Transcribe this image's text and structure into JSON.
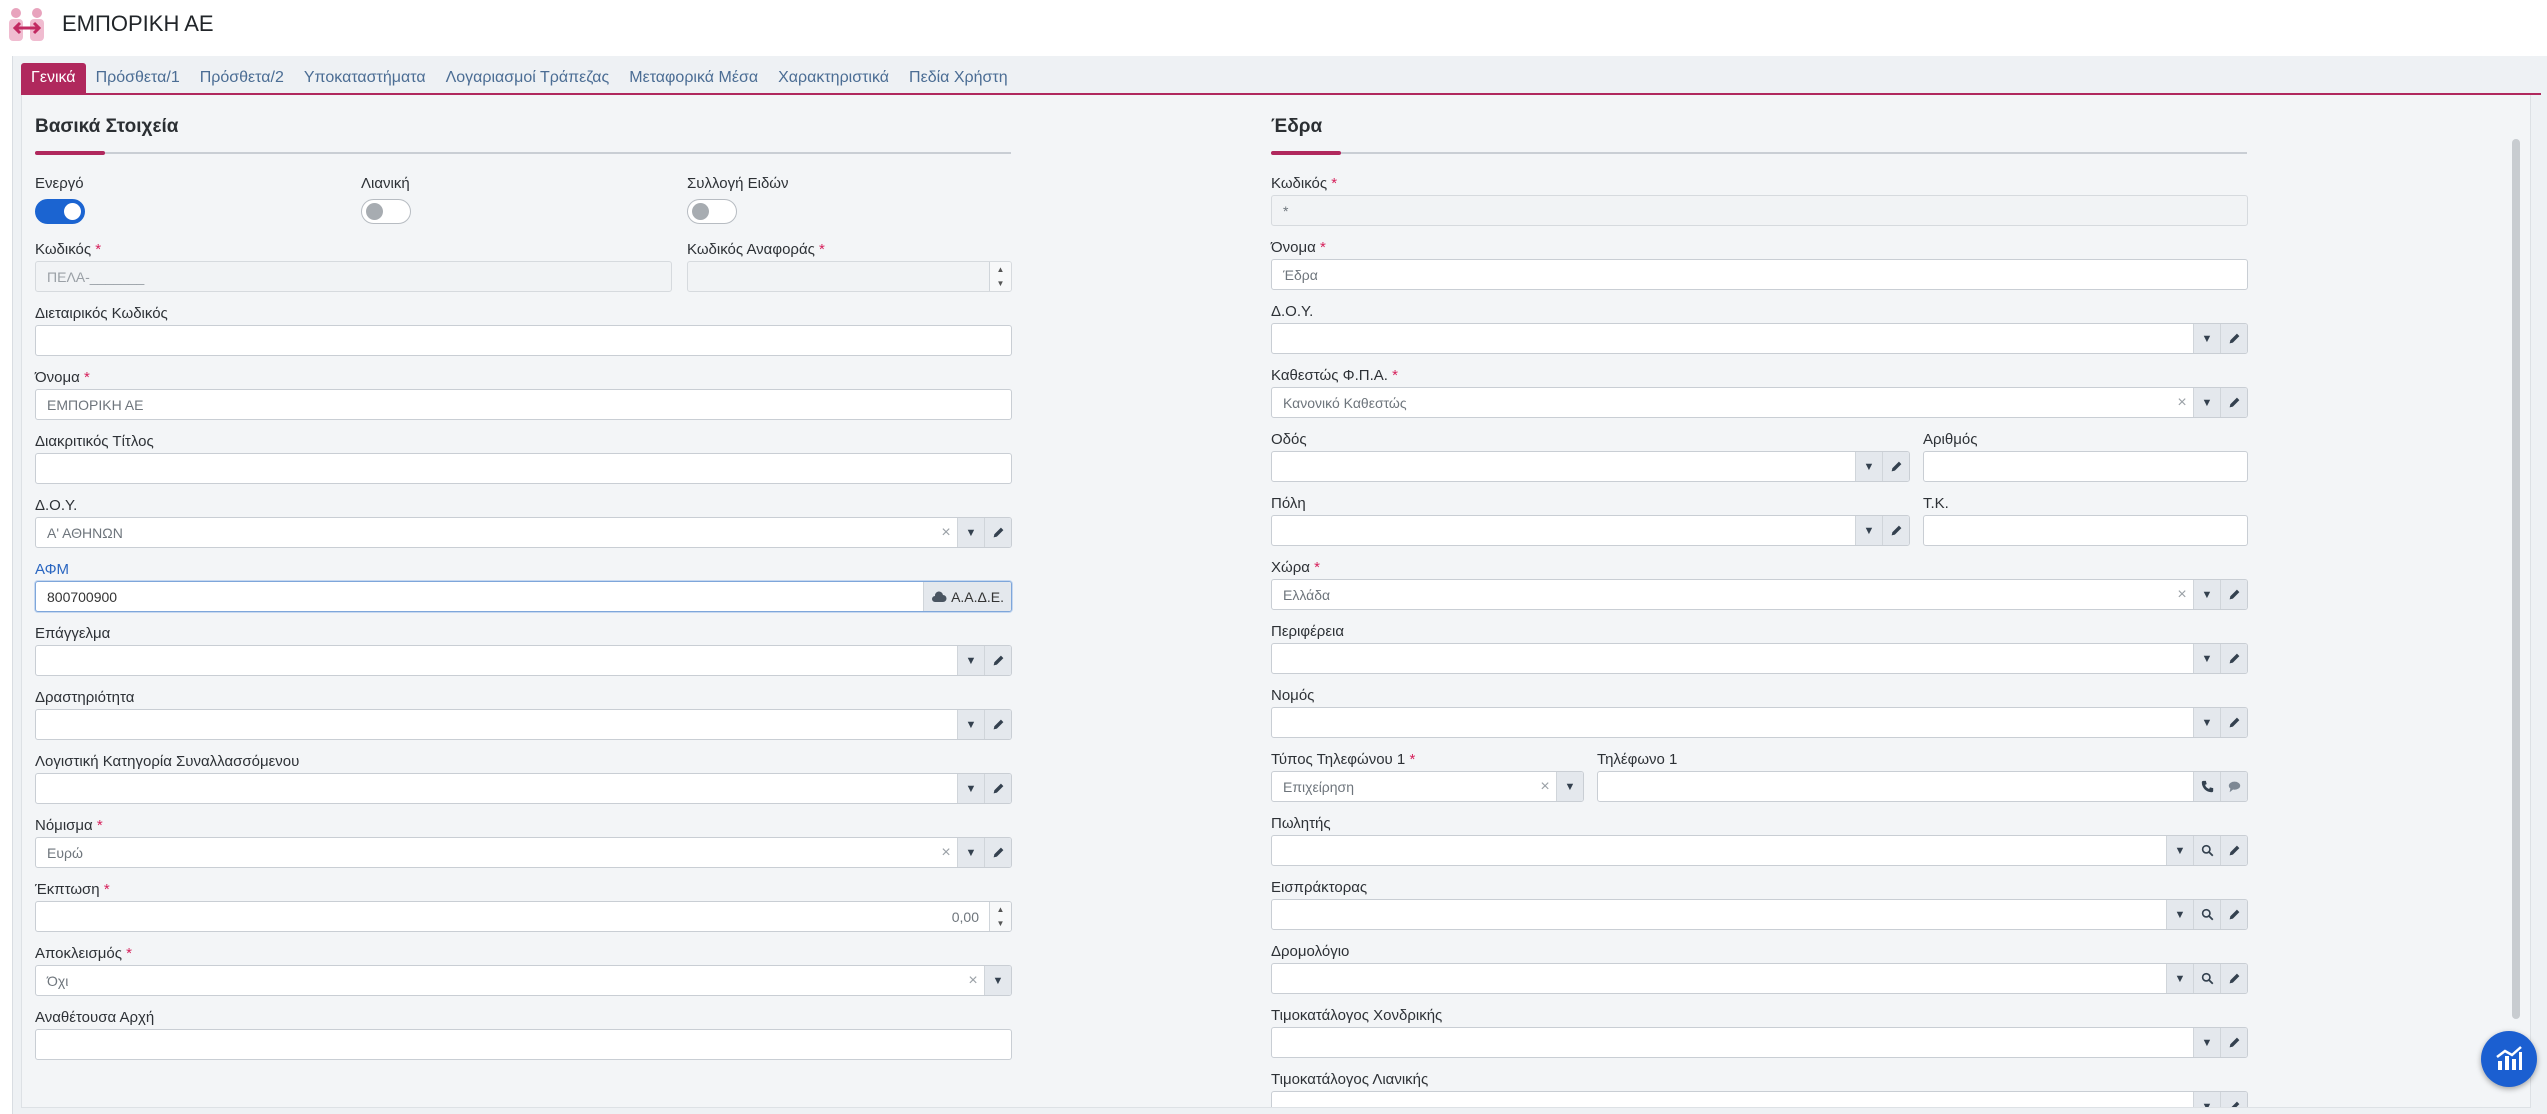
{
  "header": {
    "company_name": "ΕΜΠΟΡΙΚΗ ΑΕ"
  },
  "tabs": [
    {
      "label": "Γενικά",
      "active": true
    },
    {
      "label": "Πρόσθετα/1"
    },
    {
      "label": "Πρόσθετα/2"
    },
    {
      "label": "Υποκαταστήματα"
    },
    {
      "label": "Λογαριασμοί Τράπεζας"
    },
    {
      "label": "Μεταφορικά Μέσα"
    },
    {
      "label": "Χαρακτηριστικά"
    },
    {
      "label": "Πεδία Χρήστη"
    }
  ],
  "basic": {
    "title": "Βασικά Στοιχεία",
    "active_label": "Ενεργό",
    "retail_label": "Λιανική",
    "collect_label": "Συλλογή Ειδών",
    "code_label": "Κωδικός",
    "code_placeholder": "ΠΕΛΑ-_______",
    "ref_code_label": "Κωδικός Αναφοράς",
    "ref_code_value": "",
    "alt_code_label": "Διεταιρικός Κωδικός",
    "alt_code_value": "",
    "name_label": "Όνομα",
    "name_value": "ΕΜΠΟΡΙΚΗ ΑΕ",
    "trade_title_label": "Διακριτικός Τίτλος",
    "trade_title_value": "",
    "tax_office_label": "Δ.Ο.Υ.",
    "tax_office_value": "Α' ΑΘΗΝΩΝ",
    "vat_label": "ΑΦΜ",
    "vat_value": "800700900",
    "aade_label": "Α.Α.Δ.Ε.",
    "profession_label": "Επάγγελμα",
    "profession_value": "",
    "activity_label": "Δραστηριότητα",
    "activity_value": "",
    "account_category_label": "Λογιστική Κατηγορία Συναλλασσόμενου",
    "account_category_value": "",
    "currency_label": "Νόμισμα",
    "currency_value": "Ευρώ",
    "discount_label": "Έκπτωση",
    "discount_value": "0,00",
    "exclusion_label": "Αποκλεισμός",
    "exclusion_value": "Όχι",
    "contracting_label": "Αναθέτουσα Αρχή",
    "contracting_value": ""
  },
  "seat": {
    "title": "Έδρα",
    "code_label": "Κωδικός",
    "code_value": "*",
    "name_label": "Όνομα",
    "name_value": "Έδρα",
    "tax_office_label": "Δ.Ο.Υ.",
    "tax_office_value": "",
    "vat_status_label": "Καθεστώς Φ.Π.Α.",
    "vat_status_value": "Κανονικό Καθεστώς",
    "street_label": "Οδός",
    "street_value": "",
    "number_label": "Αριθμός",
    "number_value": "",
    "city_label": "Πόλη",
    "city_value": "",
    "zip_label": "Τ.Κ.",
    "zip_value": "",
    "country_label": "Χώρα",
    "country_value": "Ελλάδα",
    "region_label": "Περιφέρεια",
    "region_value": "",
    "prefecture_label": "Νομός",
    "prefecture_value": "",
    "phone_type_label": "Τύπος Τηλεφώνου 1",
    "phone_type_value": "Επιχείρηση",
    "phone_label": "Τηλέφωνο 1",
    "phone_value": "",
    "salesman_label": "Πωλητής",
    "salesman_value": "",
    "collector_label": "Εισπράκτορας",
    "collector_value": "",
    "route_label": "Δρομολόγιο",
    "route_value": "",
    "wholesale_label": "Τιμοκατάλογος Χονδρικής",
    "wholesale_value": "",
    "retail_price_label": "Τιμοκατάλογος Λιανικής",
    "retail_price_value": ""
  },
  "toggles": {
    "active": true,
    "retail": false,
    "collect": false
  },
  "colors": {
    "accent": "#b0285d",
    "primary": "#1b64d1",
    "link": "#4b6d94"
  },
  "icons": {
    "edit": "pencil-icon",
    "dropdown": "caret-down-icon",
    "search": "search-icon",
    "phone": "phone-icon",
    "chat": "chat-icon",
    "cloud": "cloud-icon",
    "fab": "chart-icon"
  }
}
